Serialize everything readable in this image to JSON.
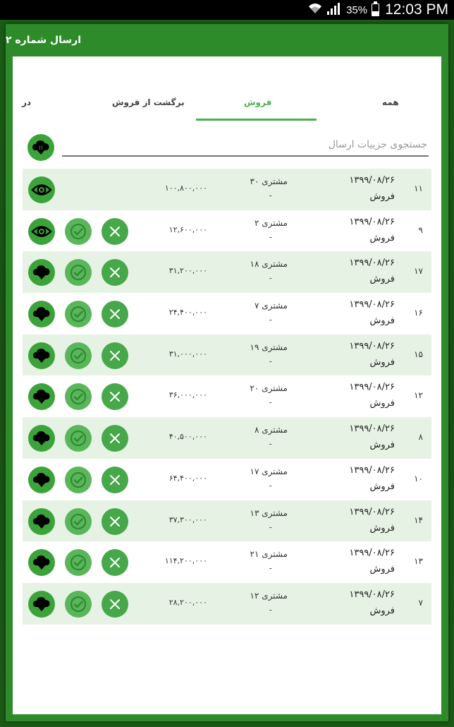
{
  "status_bar": {
    "battery": "35%",
    "time": "12:03 PM"
  },
  "dialog": {
    "title": "ارسال شماره ۲"
  },
  "tabs": [
    {
      "label": "همه",
      "active": false
    },
    {
      "label": "فروش",
      "active": true
    },
    {
      "label": "برگشت از فروش",
      "active": false
    },
    {
      "label": "در",
      "active": false
    }
  ],
  "search": {
    "placeholder": "جستجوی جزییات ارسال",
    "value": ""
  },
  "colors": {
    "accent": "#4caf50",
    "header_bg": "#2e8b2a",
    "row_shade": "#e6f3e4"
  },
  "rows": [
    {
      "index": "۱۱",
      "date": "۱۳۹۹/۰۸/۲۶",
      "type": "فروش",
      "customer": "مشتری ۳۰",
      "note": "-",
      "amount": "۱۰۰,۸۰۰,۰۰۰",
      "action_icon": "eye-icon",
      "show_approve_reject": false
    },
    {
      "index": "۹",
      "date": "۱۳۹۹/۰۸/۲۶",
      "type": "فروش",
      "customer": "مشتری ۲",
      "note": "-",
      "amount": "۱۲,۶۰۰,۰۰۰",
      "action_icon": "eye-icon",
      "show_approve_reject": true
    },
    {
      "index": "۱۷",
      "date": "۱۳۹۹/۰۸/۲۶",
      "type": "فروش",
      "customer": "مشتری ۱۸",
      "note": "-",
      "amount": "۳۱,۲۰۰,۰۰۰",
      "action_icon": "cloud-download-icon",
      "show_approve_reject": true
    },
    {
      "index": "۱۶",
      "date": "۱۳۹۹/۰۸/۲۶",
      "type": "فروش",
      "customer": "مشتری ۷",
      "note": "-",
      "amount": "۲۴,۴۰۰,۰۰۰",
      "action_icon": "cloud-download-icon",
      "show_approve_reject": true
    },
    {
      "index": "۱۵",
      "date": "۱۳۹۹/۰۸/۲۶",
      "type": "فروش",
      "customer": "مشتری ۱۹",
      "note": "-",
      "amount": "۳۱,۰۰۰,۰۰۰",
      "action_icon": "cloud-download-icon",
      "show_approve_reject": true
    },
    {
      "index": "۱۲",
      "date": "۱۳۹۹/۰۸/۲۶",
      "type": "فروش",
      "customer": "مشتری ۲۰",
      "note": "-",
      "amount": "۳۶,۰۰۰,۰۰۰",
      "action_icon": "cloud-download-icon",
      "show_approve_reject": true
    },
    {
      "index": "۸",
      "date": "۱۳۹۹/۰۸/۲۶",
      "type": "فروش",
      "customer": "مشتری ۸",
      "note": "-",
      "amount": "۴۰,۵۰۰,۰۰۰",
      "action_icon": "cloud-download-icon",
      "show_approve_reject": true
    },
    {
      "index": "۱۰",
      "date": "۱۳۹۹/۰۸/۲۶",
      "type": "فروش",
      "customer": "مشتری ۱۷",
      "note": "-",
      "amount": "۶۴,۴۰۰,۰۰۰",
      "action_icon": "cloud-download-icon",
      "show_approve_reject": true
    },
    {
      "index": "۱۴",
      "date": "۱۳۹۹/۰۸/۲۶",
      "type": "فروش",
      "customer": "مشتری ۱۳",
      "note": "-",
      "amount": "۳۷,۳۰۰,۰۰۰",
      "action_icon": "cloud-download-icon",
      "show_approve_reject": true
    },
    {
      "index": "۱۳",
      "date": "۱۳۹۹/۰۸/۲۶",
      "type": "فروش",
      "customer": "مشتری ۲۱",
      "note": "-",
      "amount": "۱۱۴,۲۰۰,۰۰۰",
      "action_icon": "cloud-download-icon",
      "show_approve_reject": true
    },
    {
      "index": "۷",
      "date": "۱۳۹۹/۰۸/۲۶",
      "type": "فروش",
      "customer": "مشتری ۱۲",
      "note": "-",
      "amount": "۲۸,۲۰۰,۰۰۰",
      "action_icon": "cloud-download-icon",
      "show_approve_reject": true
    }
  ]
}
